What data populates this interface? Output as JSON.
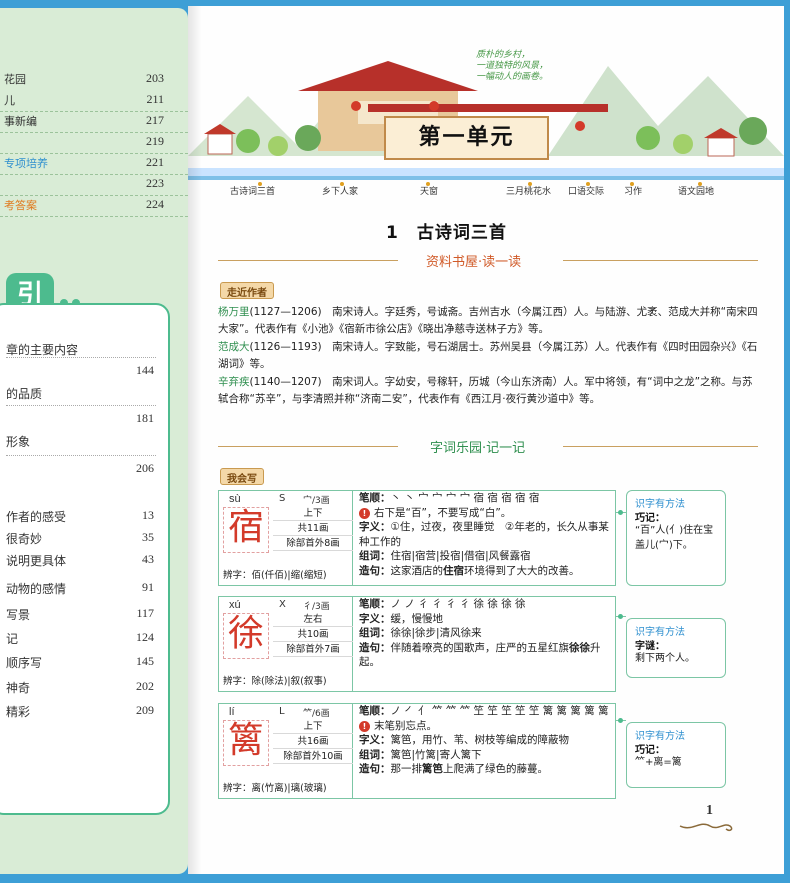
{
  "left_page": {
    "toc_top": [
      {
        "label": "花园",
        "page": "203"
      },
      {
        "label": "儿",
        "page": "211"
      },
      {
        "label": "事新编",
        "page": "217"
      },
      {
        "label": "",
        "page": "219"
      },
      {
        "label": "专项培养",
        "page": "221",
        "style": "blue"
      },
      {
        "label": "",
        "page": "223"
      },
      {
        "label": "考答案",
        "page": "224",
        "style": "orange"
      }
    ],
    "index_title": "引",
    "index_items": [
      {
        "label": "章的主要内容",
        "page": ""
      },
      {
        "label": "",
        "page": "144"
      },
      {
        "label": "的品质",
        "page": ""
      },
      {
        "label": "",
        "page": "181"
      },
      {
        "label": "形象",
        "page": ""
      },
      {
        "label": "",
        "page": "206"
      },
      {
        "label": "作者的感受",
        "page": "13"
      },
      {
        "label": "很奇妙",
        "page": "35"
      },
      {
        "label": "说明更具体",
        "page": "43"
      },
      {
        "label": "动物的感情",
        "page": "91"
      },
      {
        "label": "写景",
        "page": "117"
      },
      {
        "label": "记",
        "page": "124"
      },
      {
        "label": "顺序写",
        "page": "145"
      },
      {
        "label": "神奇",
        "page": "202"
      },
      {
        "label": "精彩",
        "page": "209"
      }
    ]
  },
  "banner": {
    "quote_lines": [
      "质朴的乡村，",
      "一道独特的风景，",
      "一幅动人的画卷。"
    ],
    "unit_title": "第一单元",
    "unit_nav": [
      "古诗词三首",
      "乡下人家",
      "天窗",
      "三月桃花水",
      "口语交际",
      "习作",
      "语文园地"
    ]
  },
  "lesson": {
    "title": "1　古诗词三首",
    "section1": "资料书屋·读一读",
    "tag1": "走近作者",
    "authors": [
      {
        "name": "杨万里",
        "years": "(1127—1206)",
        "text": "　南宋诗人。字廷秀，号诚斋。吉州吉水（今属江西）人。与陆游、尤袤、范成大并称“南宋四大家”。代表作有《小池》《宿新市徐公店》《晓出净慈寺送林子方》等。"
      },
      {
        "name": "范成大",
        "years": "(1126—1193)",
        "text": "　南宋诗人。字致能，号石湖居士。苏州吴县（今属江苏）人。代表作有《四时田园杂兴》《石湖词》等。"
      },
      {
        "name": "辛弃疾",
        "years": "(1140—1207)",
        "text": "　南宋词人。字幼安，号稼轩，历城（今山东济南）人。军中将领，有“词中之龙”之称。与苏轼合称“苏辛”，与李清照并称“济南二安”，代表作有《西江月·夜行黄沙道中》等。"
      }
    ],
    "section2": "字词乐园·记一记",
    "tag2": "我会写"
  },
  "chars": [
    {
      "pinyin": "sù",
      "initial": "S",
      "radical": "宀/3画",
      "char": "宿",
      "structure": "上下",
      "strokes": "共11画",
      "extra": "除部首外8画",
      "bianzi": "辨字：佰(仟佰)|缩(缩短)",
      "bishun_label": "笔顺：",
      "bishun": "丶 丶 宀 宀 宀 宀 宿 宿 宿 宿 宿",
      "warn": "右下是“百”，不要写成“白”。",
      "ziyi_label": "字义：",
      "ziyi": "①住，过夜，夜里睡觉　②年老的，长久从事某种工作的",
      "zuci_label": "组词：",
      "zuci": "住宿|宿营|投宿|借宿|风餐露宿",
      "zaoju_label": "造句：",
      "zaoju_pre": "这家酒店的",
      "zaoju_bold": "住宿",
      "zaoju_post": "环境得到了大大的改善。",
      "tip_title": "识字有方法",
      "tip_label": "巧记：",
      "tip_text": "“百”人(亻)住在宝盖儿(宀)下。"
    },
    {
      "pinyin": "xú",
      "initial": "X",
      "radical": "彳/3画",
      "char": "徐",
      "structure": "左右",
      "strokes": "共10画",
      "extra": "除部首外7画",
      "bianzi": "辨字：除(除法)|叙(叙事)",
      "bishun_label": "笔顺：",
      "bishun": "ノ ノ 彳 彳 彳 彳 徐 徐 徐 徐",
      "warn": "",
      "ziyi_label": "字义：",
      "ziyi": "缓，慢慢地",
      "zuci_label": "组词：",
      "zuci": "徐徐|徐步|清风徐来",
      "zaoju_label": "造句：",
      "zaoju_pre": "伴随着嘹亮的国歌声，庄严的五星红旗",
      "zaoju_bold": "徐徐",
      "zaoju_post": "升起。",
      "tip_title": "识字有方法",
      "tip_label": "字谜：",
      "tip_text": "剩下两个人。"
    },
    {
      "pinyin": "lí",
      "initial": "L",
      "radical": "⺮/6画",
      "char": "篱",
      "structure": "上下",
      "strokes": "共16画",
      "extra": "除部首外10画",
      "bianzi": "辨字：离(竹离)|璃(玻璃)",
      "bishun_label": "笔顺：",
      "bishun": "ノ ㇒ 亻 ⺮ ⺮ ⺮ 笁 笁 笁 笁 笁 篱 篱 篱 篱 篱",
      "warn": "末笔别忘点。",
      "ziyi_label": "字义：",
      "ziyi": "篱笆，用竹、苇、树枝等编成的障蔽物",
      "zuci_label": "组词：",
      "zuci": "篱笆|竹篱|寄人篱下",
      "zaoju_label": "造句：",
      "zaoju_pre": "那一排",
      "zaoju_bold": "篱笆",
      "zaoju_post": "上爬满了绿色的藤蔓。",
      "tip_title": "识字有方法",
      "tip_label": "巧记：",
      "tip_text": "⺮+离=篱"
    }
  ],
  "page_number": "1",
  "colors": {
    "accent_red": "#d33a2a",
    "accent_green": "#4dbb8e",
    "accent_blue": "#2e8fcf",
    "background": "#3d9fd6"
  }
}
